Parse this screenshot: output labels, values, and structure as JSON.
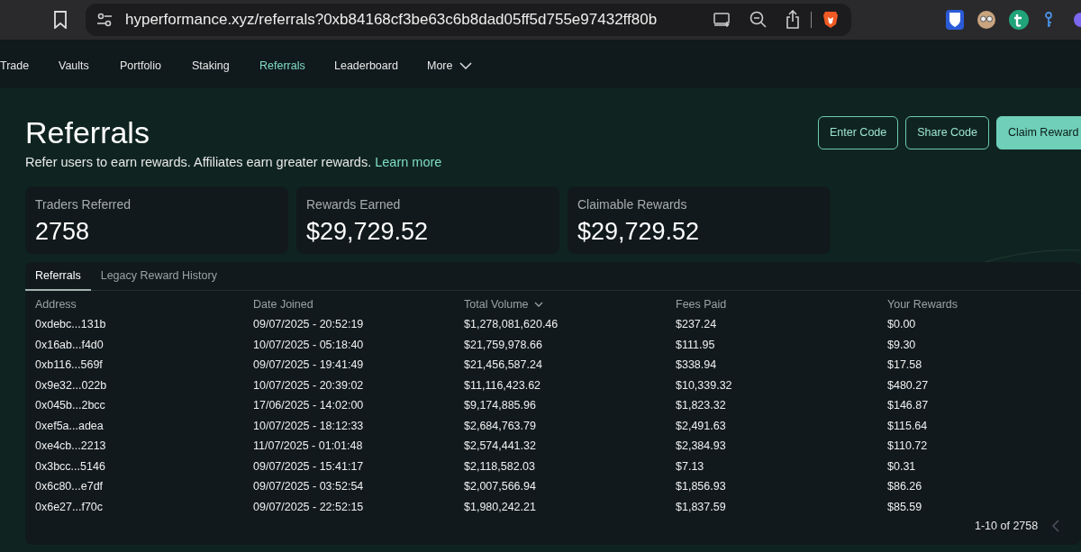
{
  "browser": {
    "url": "hyperformance.xyz/referrals?0xb84168cf3be63c6b8dad05ff5d755e97432ff80b"
  },
  "nav": [
    {
      "label": "Trade",
      "selected": false
    },
    {
      "label": "Vaults",
      "selected": false
    },
    {
      "label": "Portfolio",
      "selected": false
    },
    {
      "label": "Staking",
      "selected": false
    },
    {
      "label": "Referrals",
      "selected": true
    },
    {
      "label": "Leaderboard",
      "selected": false
    },
    {
      "label": "More",
      "selected": false
    }
  ],
  "header": {
    "title": "Referrals",
    "subtitle": "Refer users to earn rewards. Affiliates earn greater rewards.",
    "link": "Learn more",
    "buttons": [
      {
        "label": "Enter Code",
        "kind": "outline"
      },
      {
        "label": "Share Code",
        "kind": "outline"
      },
      {
        "label": "Claim Reward",
        "kind": "filled"
      }
    ]
  },
  "stats": [
    {
      "label": "Traders Referred",
      "value": "2758"
    },
    {
      "label": "Rewards Earned",
      "value": "$29,729.52"
    },
    {
      "label": "Claimable Rewards",
      "value": "$29,729.52"
    }
  ],
  "tabs": [
    {
      "label": "Referrals",
      "selected": true
    },
    {
      "label": "Legacy Reward History",
      "selected": false
    }
  ],
  "table": {
    "columns": [
      {
        "label": "Address",
        "sorted": false
      },
      {
        "label": "Date Joined",
        "sorted": false
      },
      {
        "label": "Total Volume",
        "sorted": true
      },
      {
        "label": "Fees Paid",
        "sorted": false
      },
      {
        "label": "Your Rewards",
        "sorted": false
      }
    ],
    "rows": [
      [
        "0xdebc...131b",
        "09/07/2025 - 20:52:19",
        "$1,278,081,620.46",
        "$237.24",
        "$0.00"
      ],
      [
        "0x16ab...f4d0",
        "10/07/2025 - 05:18:40",
        "$21,759,978.66",
        "$111.95",
        "$9.30"
      ],
      [
        "0xb116...569f",
        "09/07/2025 - 19:41:49",
        "$21,456,587.24",
        "$338.94",
        "$17.58"
      ],
      [
        "0x9e32...022b",
        "10/07/2025 - 20:39:02",
        "$11,116,423.62",
        "$10,339.32",
        "$480.27"
      ],
      [
        "0x045b...2bcc",
        "17/06/2025 - 14:02:00",
        "$9,174,885.96",
        "$1,823.32",
        "$146.87"
      ],
      [
        "0xef5a...adea",
        "10/07/2025 - 18:12:33",
        "$2,684,763.79",
        "$2,491.63",
        "$115.64"
      ],
      [
        "0xe4cb...2213",
        "11/07/2025 - 01:01:48",
        "$2,574,441.32",
        "$2,384.93",
        "$110.72"
      ],
      [
        "0x3bcc...5146",
        "09/07/2025 - 15:41:17",
        "$2,118,582.03",
        "$7.13",
        "$0.31"
      ],
      [
        "0x6c80...e7df",
        "09/07/2025 - 03:52:54",
        "$2,007,566.94",
        "$1,856.93",
        "$86.26"
      ],
      [
        "0x6e27...f70c",
        "09/07/2025 - 22:52:15",
        "$1,980,242.21",
        "$1,837.59",
        "$85.59"
      ]
    ]
  },
  "pagination": {
    "range": "1-10 of 2758"
  }
}
